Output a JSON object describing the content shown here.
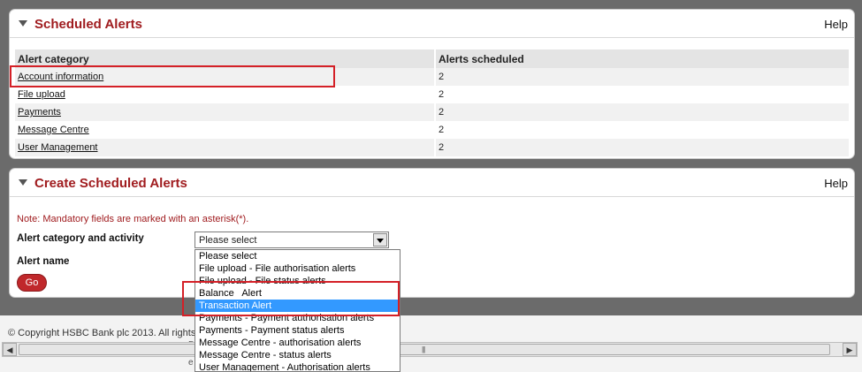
{
  "scheduled": {
    "title": "Scheduled Alerts",
    "help": "Help",
    "columns": [
      "Alert category",
      "Alerts scheduled"
    ],
    "rows": [
      {
        "category": "Account information",
        "count": "2"
      },
      {
        "category": "File upload",
        "count": "2"
      },
      {
        "category": "Payments",
        "count": "2"
      },
      {
        "category": "Message Centre",
        "count": "2"
      },
      {
        "category": "User Management",
        "count": "2"
      }
    ]
  },
  "create": {
    "title": "Create Scheduled Alerts",
    "help": "Help",
    "note": "Note: Mandatory fields are marked with an asterisk(*).",
    "category_label": "Alert category and activity",
    "name_label": "Alert name",
    "go": "Go",
    "select_value": "Please select",
    "options": [
      "Please select",
      "File upload - File authorisation alerts",
      "File upload - File status alerts",
      "Balance   Alert",
      "Transaction Alert",
      "Payments - Payment authorisation alerts",
      "Payments - Payment status alerts",
      "Message Centre - authorisation alerts",
      "Message Centre - status alerts",
      "User Management - Authorisation alerts"
    ],
    "highlighted_option": "Transaction Alert"
  },
  "footer": {
    "copyright": "© Copyright HSBC Bank plc 2013. All rights",
    "frag1": "D",
    "frag2": "e"
  },
  "colors": {
    "brand_red": "#a01c1f",
    "highlight": "#d42027",
    "selection": "#3399ff"
  }
}
